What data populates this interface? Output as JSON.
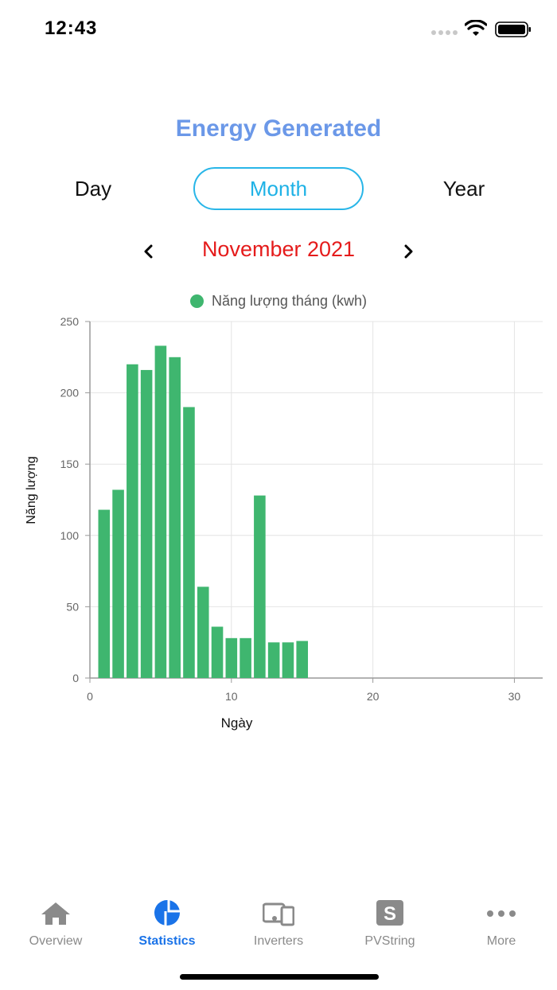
{
  "status_bar": {
    "time": "12:43"
  },
  "title": "Energy Generated",
  "period_tabs": [
    {
      "label": "Day",
      "active": false
    },
    {
      "label": "Month",
      "active": true
    },
    {
      "label": "Year",
      "active": false
    }
  ],
  "period_label": "November 2021",
  "colors": {
    "accent": "#1fb2e6",
    "title": "#6b98e8",
    "period": "#e51b1b",
    "bar": "#3fb66f",
    "tab_active": "#1a73e8"
  },
  "chart_data": {
    "type": "bar",
    "legend": [
      "Năng lượng tháng (kwh)"
    ],
    "legend_position": "top",
    "xlabel": "Ngày",
    "ylabel": "Năng lượng",
    "xlim": [
      0,
      32
    ],
    "ylim": [
      0,
      250
    ],
    "xticks": [
      0,
      10,
      20,
      30
    ],
    "yticks": [
      0,
      50,
      100,
      150,
      200,
      250
    ],
    "grid": true,
    "series": [
      {
        "name": "Năng lượng tháng (kwh)",
        "x": [
          1,
          2,
          3,
          4,
          5,
          6,
          7,
          8,
          9,
          10,
          11,
          12,
          13,
          14,
          15
        ],
        "values": [
          118,
          132,
          220,
          216,
          233,
          225,
          190,
          64,
          36,
          28,
          28,
          128,
          25,
          25,
          26
        ]
      }
    ]
  },
  "tab_bar": [
    {
      "label": "Overview",
      "icon": "home-icon",
      "active": false
    },
    {
      "label": "Statistics",
      "icon": "pie-chart-icon",
      "active": true
    },
    {
      "label": "Inverters",
      "icon": "inverter-icon",
      "active": false
    },
    {
      "label": "PVString",
      "icon": "pvstring-icon",
      "active": false
    },
    {
      "label": "More",
      "icon": "more-icon",
      "active": false
    }
  ]
}
